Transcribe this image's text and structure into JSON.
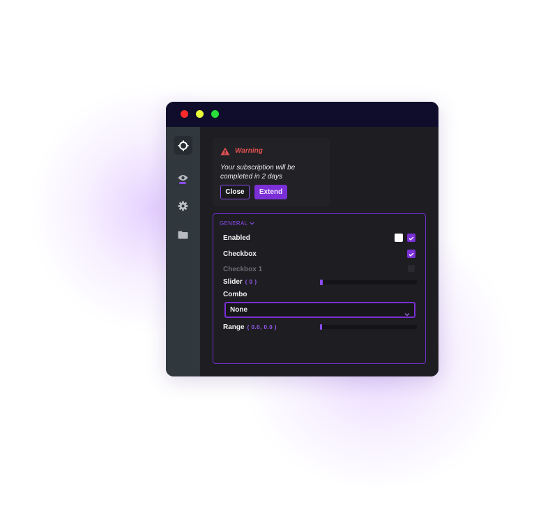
{
  "colors": {
    "accent": "#7b2fd6",
    "accent_light": "#8a4cf0",
    "warning": "#e05050",
    "titlebar": "#0f0d2b",
    "sidebar": "#30373d",
    "content_bg": "#1e1d22"
  },
  "window_controls": [
    "close",
    "minimize",
    "maximize"
  ],
  "sidebar": {
    "items": [
      {
        "icon": "crosshair-icon",
        "active": true
      },
      {
        "icon": "eye-icon",
        "active": false
      },
      {
        "icon": "gear-icon",
        "active": false
      },
      {
        "icon": "folder-icon",
        "active": false
      }
    ]
  },
  "warning": {
    "icon": "warning-triangle-icon",
    "title": "Warning",
    "message": "Your subscription will be completed in 2 days",
    "close_label": "Close",
    "extend_label": "Extend"
  },
  "panel": {
    "section_label": "GENERAL",
    "enabled_label": "Enabled",
    "enabled_states": [
      false,
      true
    ],
    "checkbox_label": "Checkbox",
    "checkbox_checked": true,
    "checkbox1_label": "Checkbox 1",
    "checkbox1_checked": false,
    "checkbox1_disabled": true,
    "slider_label": "Slider",
    "slider_value": "( 0 )",
    "slider_level": 0,
    "combo_label": "Combo",
    "combo_value": "None",
    "range_label": "Range",
    "range_value": "( 0.0, 0.0 )",
    "range_low": 0.0,
    "range_high": 0.0
  }
}
